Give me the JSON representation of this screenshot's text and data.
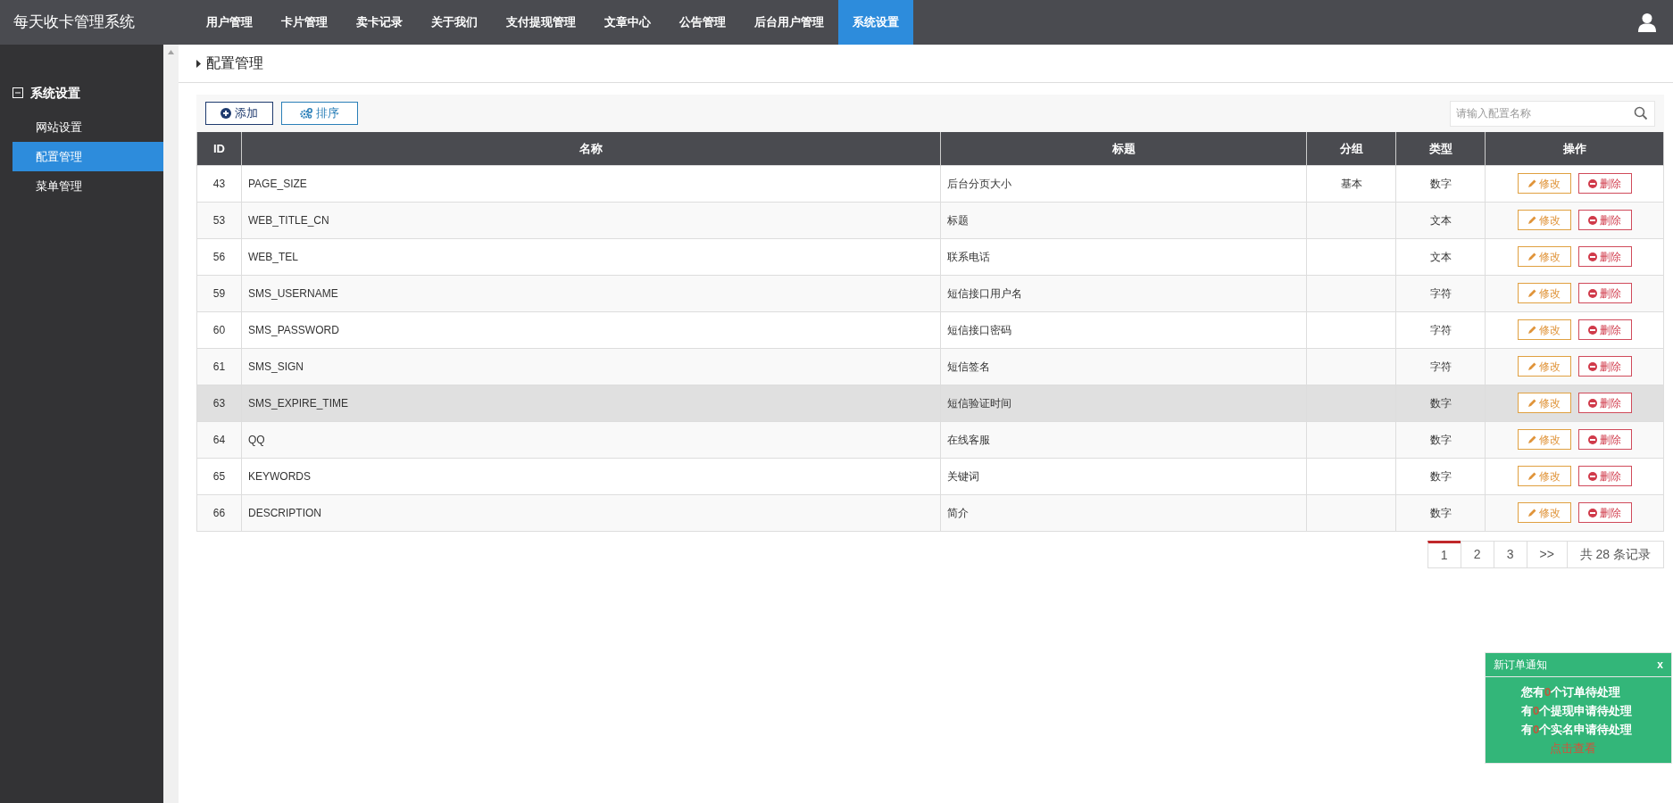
{
  "app_title": "每天收卡管理系统",
  "nav": [
    {
      "label": "用户管理",
      "selected": false
    },
    {
      "label": "卡片管理",
      "selected": false
    },
    {
      "label": "卖卡记录",
      "selected": false
    },
    {
      "label": "关于我们",
      "selected": false
    },
    {
      "label": "支付提现管理",
      "selected": false
    },
    {
      "label": "文章中心",
      "selected": false
    },
    {
      "label": "公告管理",
      "selected": false
    },
    {
      "label": "后台用户管理",
      "selected": false
    },
    {
      "label": "系统设置",
      "selected": true
    }
  ],
  "sidebar": {
    "section": "系统设置",
    "expanded": true,
    "items": [
      {
        "label": "网站设置",
        "selected": false
      },
      {
        "label": "配置管理",
        "selected": true
      },
      {
        "label": "菜单管理",
        "selected": false
      }
    ]
  },
  "page_title": "配置管理",
  "toolbar": {
    "buttons": [
      {
        "kind": "add",
        "label": "添加"
      },
      {
        "kind": "sort",
        "label": "排序"
      }
    ],
    "search": {
      "placeholder": "请输入配置名称"
    }
  },
  "table": {
    "columns": [
      "ID",
      "名称",
      "标题",
      "分组",
      "类型",
      "操作"
    ],
    "rows": [
      {
        "id": "43",
        "name": "PAGE_SIZE",
        "title": "后台分页大小",
        "group": "基本",
        "type": "数字",
        "highlighted": false,
        "actions": [
          "修改",
          "删除"
        ]
      },
      {
        "id": "53",
        "name": "WEB_TITLE_CN",
        "title": "标题",
        "type": "文本",
        "highlighted": false,
        "actions": [
          "修改",
          "删除"
        ]
      },
      {
        "id": "56",
        "name": "WEB_TEL",
        "title": "联系电话",
        "type": "文本",
        "highlighted": false,
        "actions": [
          "修改",
          "删除"
        ]
      },
      {
        "id": "59",
        "name": "SMS_USERNAME",
        "title": "短信接口用户名",
        "type": "字符",
        "highlighted": false,
        "actions": [
          "修改",
          "删除"
        ]
      },
      {
        "id": "60",
        "name": "SMS_PASSWORD",
        "title": "短信接口密码",
        "type": "字符",
        "highlighted": false,
        "actions": [
          "修改",
          "删除"
        ]
      },
      {
        "id": "61",
        "name": "SMS_SIGN",
        "title": "短信签名",
        "type": "字符",
        "highlighted": false,
        "actions": [
          "修改",
          "删除"
        ]
      },
      {
        "id": "63",
        "name": "SMS_EXPIRE_TIME",
        "title": "短信验证时间",
        "type": "数字",
        "highlighted": true,
        "actions": [
          "修改",
          "删除"
        ]
      },
      {
        "id": "64",
        "name": "QQ",
        "title": "在线客服",
        "type": "数字",
        "highlighted": false,
        "actions": [
          "修改",
          "删除"
        ]
      },
      {
        "id": "65",
        "name": "KEYWORDS",
        "title": "关键词",
        "type": "数字",
        "highlighted": false,
        "actions": [
          "修改",
          "删除"
        ]
      },
      {
        "id": "66",
        "name": "DESCRIPTION",
        "title": "简介",
        "type": "数字",
        "highlighted": false,
        "actions": [
          "修改",
          "删除"
        ]
      }
    ]
  },
  "pagination": {
    "pages": [
      {
        "label": "1",
        "selected": true
      },
      {
        "label": "2",
        "selected": false
      },
      {
        "label": "3",
        "selected": false
      }
    ],
    "next": ">>",
    "total": "共 28 条记录"
  },
  "notification": {
    "title": "新订单通知",
    "close": "x",
    "lines": [
      {
        "before": "您有",
        "count": "0",
        "after": "个订单待处理"
      },
      {
        "before": "有",
        "count": "0",
        "after": "个提现申请待处理"
      },
      {
        "before": "有",
        "count": "0",
        "after": "个实名申请待处理"
      }
    ],
    "link": "点击查看"
  }
}
